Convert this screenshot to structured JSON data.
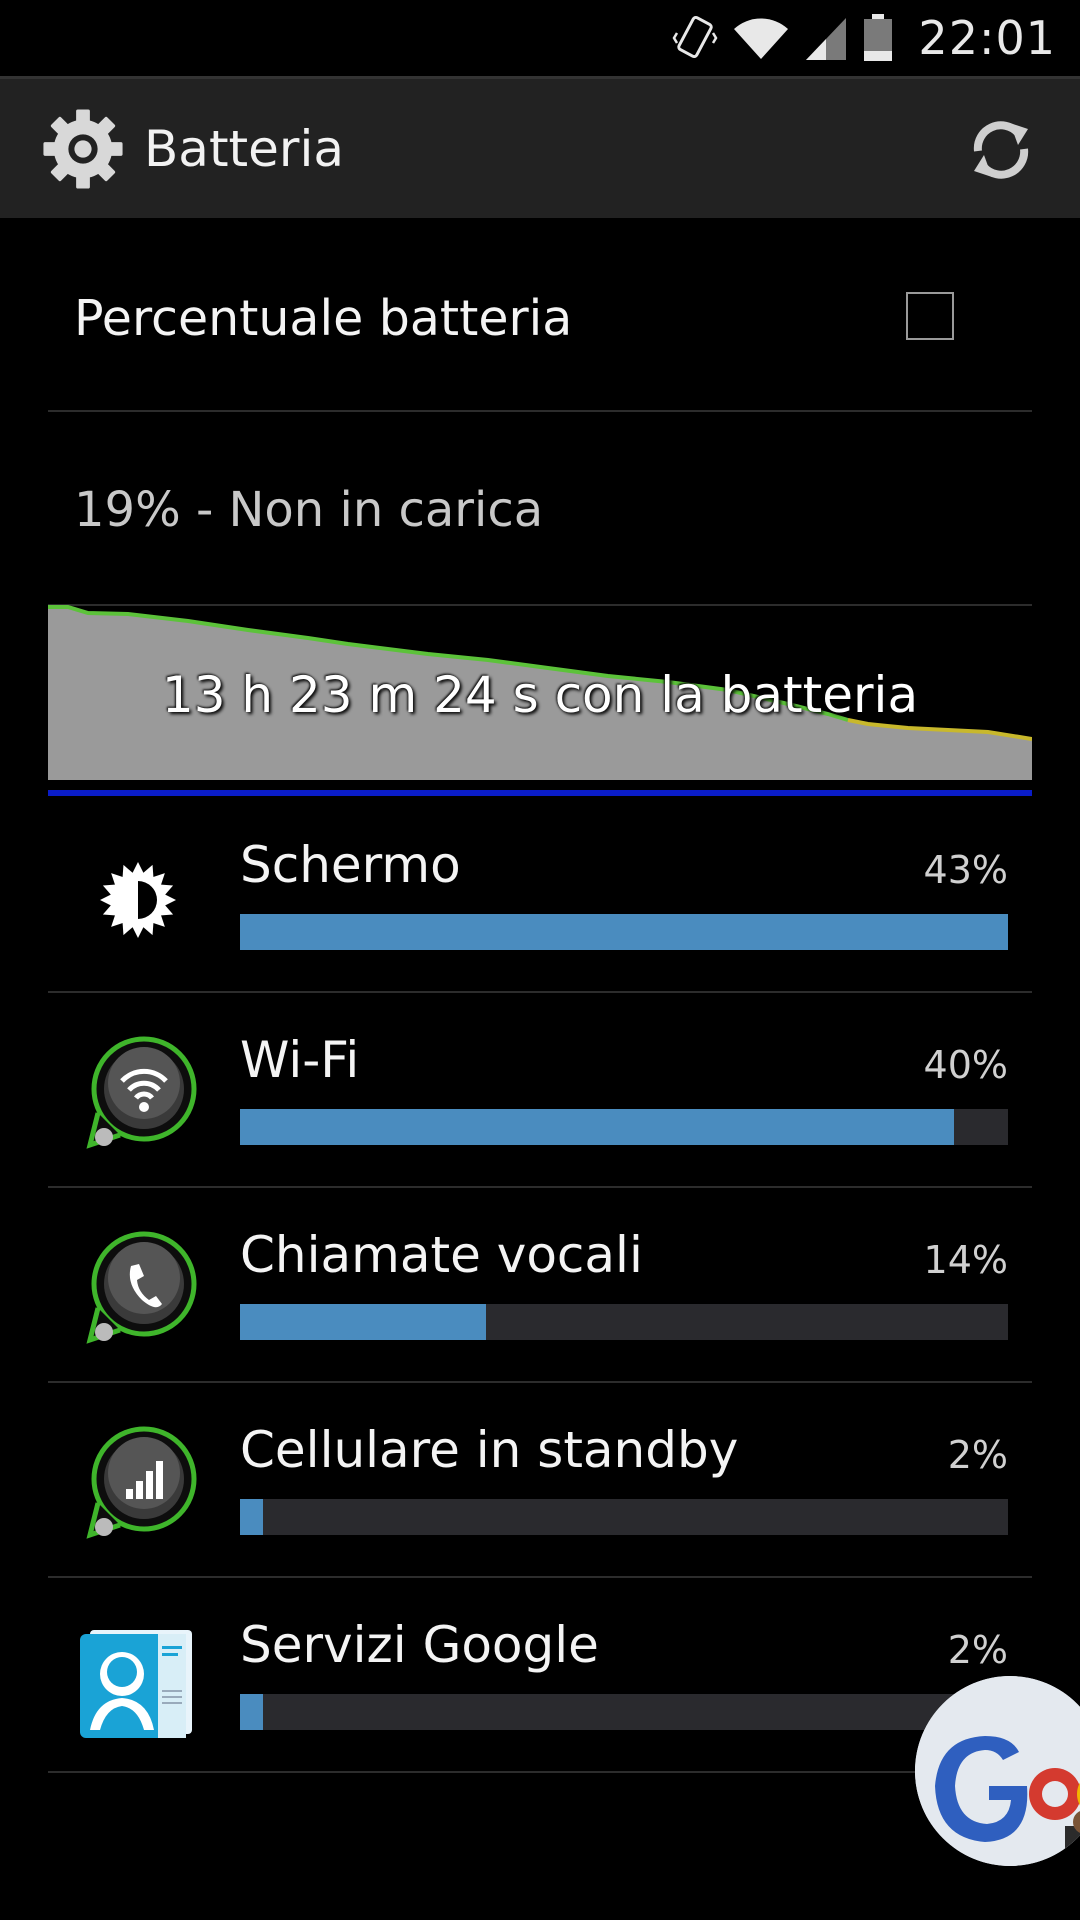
{
  "status_bar": {
    "time": "22:01",
    "icons": [
      "vibrate-icon",
      "wifi-icon",
      "signal-icon",
      "battery-icon"
    ]
  },
  "action_bar": {
    "title": "Batteria",
    "app_icon": "settings-gear-icon",
    "refresh_icon": "refresh-icon"
  },
  "preferences": {
    "battery_percentage_label": "Percentuale batteria",
    "battery_percentage_checked": false
  },
  "battery_status": "19% - Non in carica",
  "graph": {
    "caption": "13 h 23 m 24 s con la batteria",
    "line_colors": {
      "good": "#5cc23a",
      "low": "#c8b82c",
      "fill": "#9a9a9a",
      "baseline": "#0a1cc8"
    }
  },
  "usage": [
    {
      "name": "Schermo",
      "percent_label": "43%",
      "fill": 1.0,
      "icon": "brightness-icon"
    },
    {
      "name": "Wi-Fi",
      "percent_label": "40%",
      "fill": 0.93,
      "icon": "wifi-widget-icon"
    },
    {
      "name": "Chiamate vocali",
      "percent_label": "14%",
      "fill": 0.32,
      "icon": "phone-widget-icon"
    },
    {
      "name": "Cellulare in standby",
      "percent_label": "2%",
      "fill": 0.03,
      "icon": "cell-signal-widget-icon"
    },
    {
      "name": "Servizi Google",
      "percent_label": "2%",
      "fill": 0.03,
      "icon": "contacts-app-icon"
    }
  ],
  "colors": {
    "bar_fill": "#4a8cbf",
    "bar_track": "#2a2a2e",
    "divider": "#2c2c2c"
  }
}
